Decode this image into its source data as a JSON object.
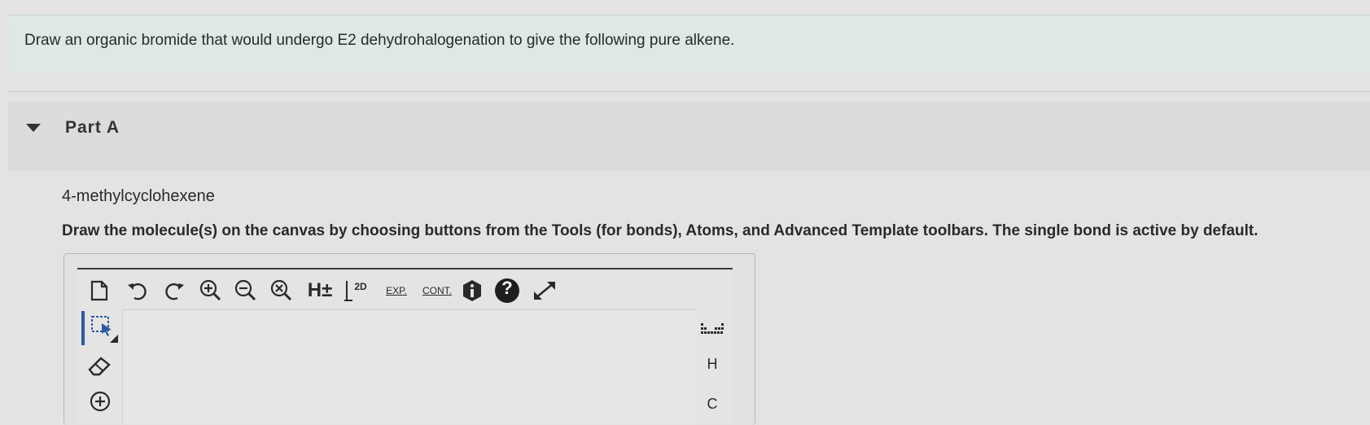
{
  "question": {
    "text": "Draw an organic bromide that would undergo E2 dehydrohalogenation to give the following pure alkene."
  },
  "part": {
    "label": "Part A",
    "compound_name": "4-methylcyclohexene",
    "instructions": "Draw the molecule(s) on the canvas by choosing buttons from the Tools (for bonds), Atoms, and Advanced Template toolbars. The single bond is active by default."
  },
  "toolbar": {
    "h_label": "H±",
    "clean2d_label": "2D",
    "expand_label": "EXP.",
    "contract_label": "CONT.",
    "help_label": "?"
  },
  "atoms": [
    {
      "symbol": "H"
    },
    {
      "symbol": "C"
    }
  ],
  "colors": {
    "banner": "#dde9e2",
    "page_bg": "#e3e3e1",
    "selected_tool": "#2c5aa0"
  }
}
